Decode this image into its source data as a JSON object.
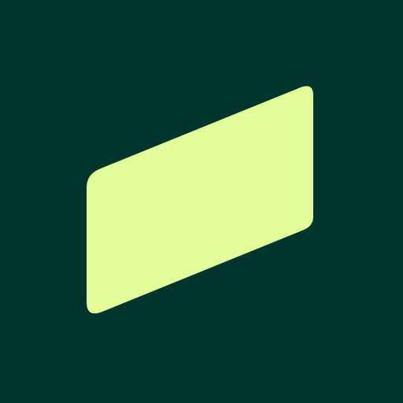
{
  "logo": {
    "icon_name": "slanted-parallelogram-logo-icon",
    "colors": {
      "background": "#02352E",
      "shape": "#E3FC9A"
    }
  }
}
